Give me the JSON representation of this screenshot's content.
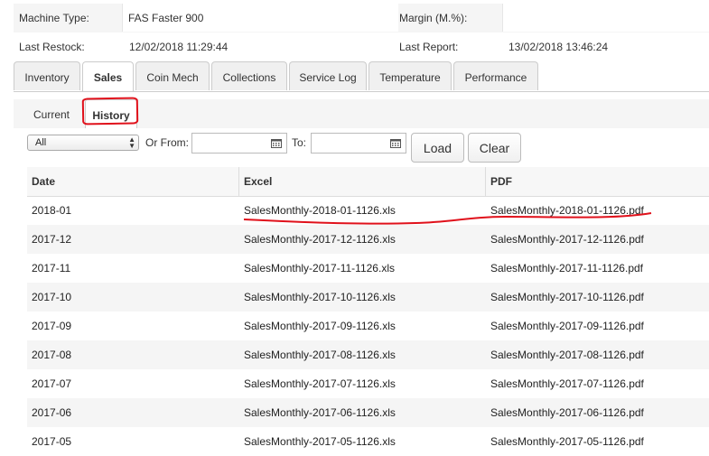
{
  "machine": {
    "type_label": "Machine Type:",
    "type_value": "FAS Faster 900",
    "margin_label": "Margin (M.%):",
    "margin_value": "",
    "restock_label": "Last Restock:",
    "restock_value": "12/02/2018 11:29:44",
    "report_label": "Last Report:",
    "report_value": "13/02/2018 13:46:24"
  },
  "tabs": [
    {
      "label": "Inventory",
      "active": false
    },
    {
      "label": "Sales",
      "active": true
    },
    {
      "label": "Coin Mech",
      "active": false
    },
    {
      "label": "Collections",
      "active": false
    },
    {
      "label": "Service Log",
      "active": false
    },
    {
      "label": "Temperature",
      "active": false
    },
    {
      "label": "Performance",
      "active": false
    }
  ],
  "subtabs": [
    {
      "label": "Current",
      "active": false
    },
    {
      "label": "History",
      "active": true
    }
  ],
  "filter": {
    "select_value": "All",
    "or_from_label": "Or From:",
    "from_value": "",
    "to_label": "To:",
    "to_value": "",
    "load_label": "Load",
    "clear_label": "Clear"
  },
  "table": {
    "columns": [
      "Date",
      "Excel",
      "PDF"
    ],
    "rows": [
      [
        "2018-01",
        "SalesMonthly-2018-01-1126.xls",
        "SalesMonthly-2018-01-1126.pdf"
      ],
      [
        "2017-12",
        "SalesMonthly-2017-12-1126.xls",
        "SalesMonthly-2017-12-1126.pdf"
      ],
      [
        "2017-11",
        "SalesMonthly-2017-11-1126.xls",
        "SalesMonthly-2017-11-1126.pdf"
      ],
      [
        "2017-10",
        "SalesMonthly-2017-10-1126.xls",
        "SalesMonthly-2017-10-1126.pdf"
      ],
      [
        "2017-09",
        "SalesMonthly-2017-09-1126.xls",
        "SalesMonthly-2017-09-1126.pdf"
      ],
      [
        "2017-08",
        "SalesMonthly-2017-08-1126.xls",
        "SalesMonthly-2017-08-1126.pdf"
      ],
      [
        "2017-07",
        "SalesMonthly-2017-07-1126.xls",
        "SalesMonthly-2017-07-1126.pdf"
      ],
      [
        "2017-06",
        "SalesMonthly-2017-06-1126.xls",
        "SalesMonthly-2017-06-1126.pdf"
      ],
      [
        "2017-05",
        "SalesMonthly-2017-05-1126.xls",
        "SalesMonthly-2017-05-1126.pdf"
      ]
    ]
  },
  "colors": {
    "annotation": "#e0111b",
    "row_alt": "#f5f5f5",
    "border": "#cccccc"
  },
  "icons": {
    "calendar": "calendar-icon",
    "select_arrows": "select-arrows-icon"
  }
}
